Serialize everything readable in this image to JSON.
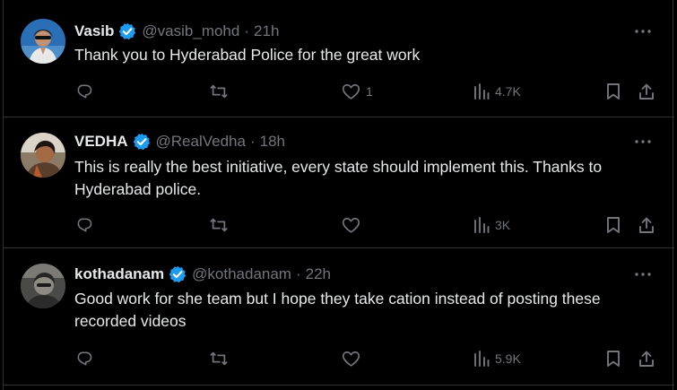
{
  "colors": {
    "background": "#000000",
    "border": "#2f3336",
    "primary_text": "#e7e9ea",
    "secondary_text": "#71767b",
    "verified": "#1d9bf0"
  },
  "tweets": [
    {
      "name": "Vasib",
      "handle": "@vasib_mohd",
      "separator": "·",
      "time": "21h",
      "verified": true,
      "text": "Thank you to Hyderabad Police for the great work",
      "likes": "1",
      "views": "4.7K"
    },
    {
      "name": "VEDHA",
      "handle": "@RealVedha",
      "separator": "·",
      "time": "18h",
      "verified": true,
      "text": "This is really the best initiative,  every state should implement this. Thanks to Hyderabad police.",
      "likes": "",
      "views": "3K"
    },
    {
      "name": "kothadanam",
      "handle": "@kothadanam",
      "separator": "·",
      "time": "22h",
      "verified": true,
      "text": "Good work for she team but I hope they take cation instead of posting these recorded videos",
      "likes": "",
      "views": "5.9K"
    }
  ],
  "icons": {
    "more": "more-icon",
    "reply": "reply-icon",
    "retweet": "retweet-icon",
    "like": "heart-icon",
    "views": "views-icon",
    "bookmark": "bookmark-icon",
    "share": "share-icon",
    "verified": "verified-badge-icon"
  }
}
